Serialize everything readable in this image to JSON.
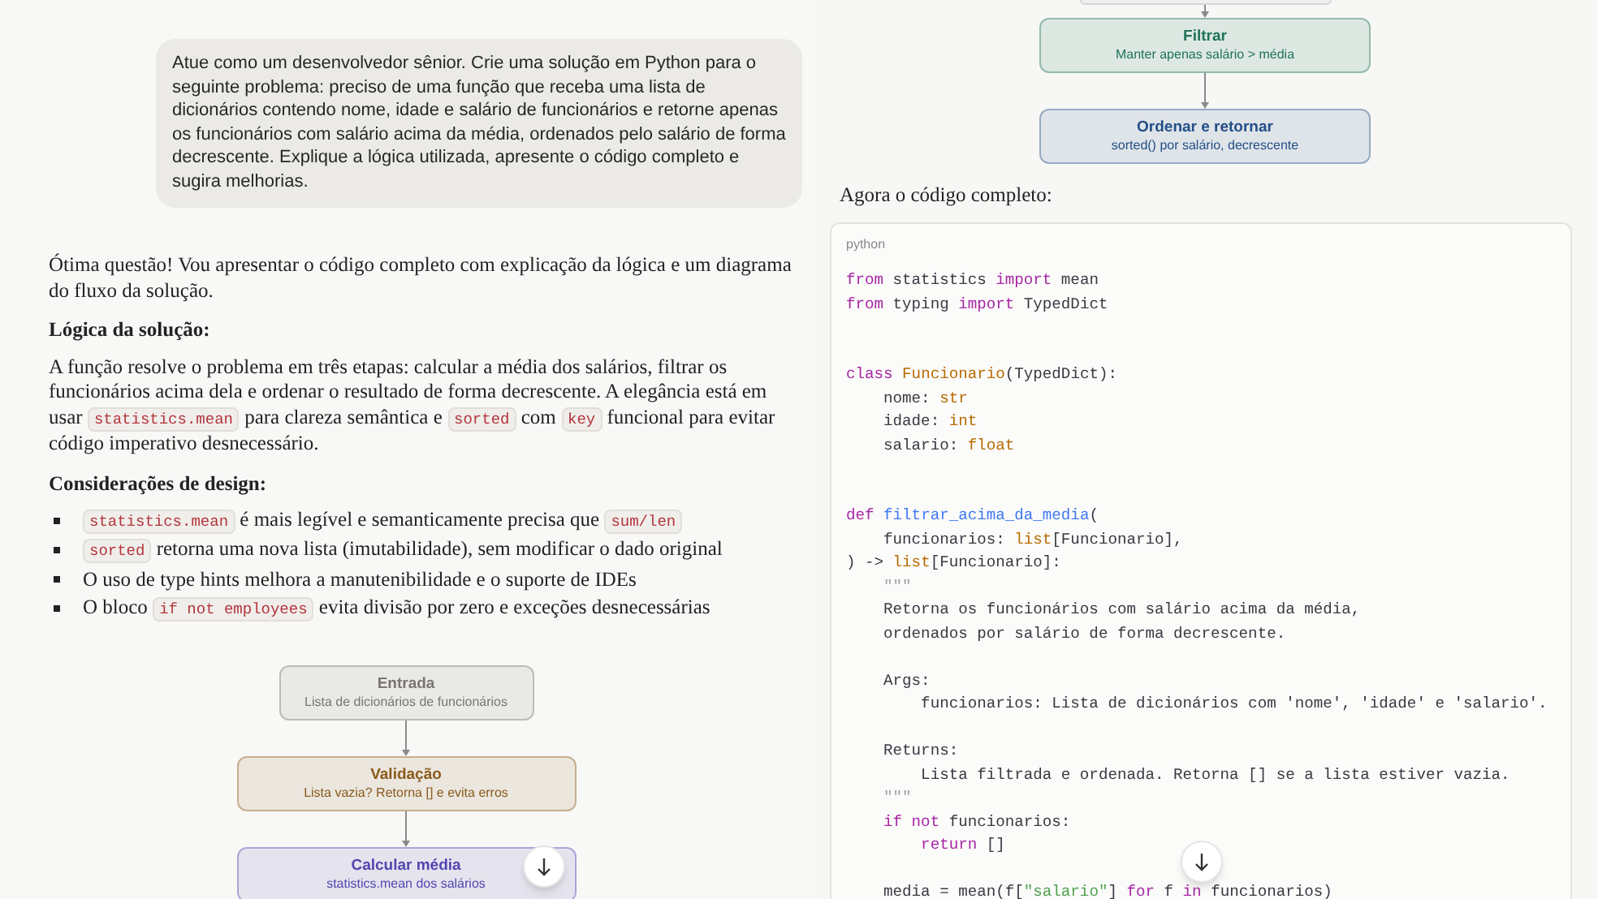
{
  "left_pane": {
    "user_message": "Atue como um desenvolvedor sênior. Crie uma solução em Python para o seguinte problema: preciso de uma função que receba uma lista de dicionários contendo nome, idade e salário de funcionários e retorne apenas os funcionários com salário acima da média, ordenados pelo salário de forma decrescente. Explique a lógica utilizada, apresente o código completo e sugira melhorias.",
    "reply_intro": "Ótima questão! Vou apresentar o código completo com explicação da lógica e um diagrama do fluxo da solução.",
    "sections": [
      {
        "heading": "Lógica da solução:",
        "kind": "paragraph",
        "paragraphs": [
          [
            {
              "text": "A função resolve o problema em três etapas: calcular a média dos salários, filtrar os funcionários acima dela e ordenar o resultado de forma decrescente. A elegância está em usar ",
              "code": false
            },
            {
              "text": "statistics.mean",
              "code": true
            },
            {
              "text": " para clareza semântica e ",
              "code": false
            },
            {
              "text": "sorted",
              "code": true
            },
            {
              "text": " com ",
              "code": false
            },
            {
              "text": "key",
              "code": true
            },
            {
              "text": " funcional para evitar código imperativo desnecessário.",
              "code": false
            }
          ]
        ]
      },
      {
        "heading": "Considerações de design:",
        "kind": "bullets",
        "paragraphs": [
          [
            {
              "text": "statistics.mean",
              "code": true
            },
            {
              "text": " é mais legível e semanticamente precisa que ",
              "code": false
            },
            {
              "text": "sum/len",
              "code": true
            }
          ],
          [
            {
              "text": "sorted",
              "code": true
            },
            {
              "text": " retorna uma nova lista (imutabilidade), sem modificar o dado original",
              "code": false
            }
          ],
          [
            {
              "text": "O uso de type hints melhora a manutenibilidade e o suporte de IDEs",
              "code": false
            }
          ],
          [
            {
              "text": "O bloco ",
              "code": false
            },
            {
              "text": "if not employees",
              "code": true
            },
            {
              "text": " evita divisão por zero e exceções desnecessárias",
              "code": false
            }
          ]
        ]
      }
    ],
    "flowchart": [
      {
        "title": "Entrada",
        "subtitle": "Lista de dicionários de funcionários",
        "color": "#7a7670"
      },
      {
        "title": "Validação",
        "subtitle": "Lista vazia? Retorna [] e evita erros",
        "color": "#8a5a1c"
      },
      {
        "title": "Calcular média",
        "subtitle": "statistics.mean dos salários",
        "color": "#5346b0"
      }
    ]
  },
  "right_pane": {
    "flowchart": [
      {
        "title": "Filtrar",
        "subtitle": "Manter apenas salário > média",
        "color": "#1f7456"
      },
      {
        "title": "Ordenar e retornar",
        "subtitle": "sorted() por salário, decrescente",
        "color": "#234f86"
      }
    ],
    "code_intro": "Agora o código completo:",
    "code_block": {
      "language": "python",
      "lines": [
        {
          "tokens": [
            {
              "kind": "keyword",
              "text": "from"
            },
            {
              "kind": "plain",
              "text": " statistics "
            },
            {
              "kind": "keyword",
              "text": "import"
            },
            {
              "kind": "plain",
              "text": " mean"
            }
          ]
        },
        {
          "tokens": [
            {
              "kind": "keyword",
              "text": "from"
            },
            {
              "kind": "plain",
              "text": " typing "
            },
            {
              "kind": "keyword",
              "text": "import"
            },
            {
              "kind": "plain",
              "text": " TypedDict"
            }
          ]
        },
        {
          "kind": "blank"
        },
        {
          "kind": "blank"
        },
        {
          "tokens": [
            {
              "kind": "keyword",
              "text": "class"
            },
            {
              "kind": "type",
              "text": " Funcionario"
            },
            {
              "kind": "plain",
              "text": "(TypedDict):"
            }
          ]
        },
        {
          "tokens": [
            {
              "kind": "plain",
              "text": "    nome: "
            },
            {
              "kind": "type",
              "text": "str"
            }
          ]
        },
        {
          "tokens": [
            {
              "kind": "plain",
              "text": "    idade: "
            },
            {
              "kind": "type",
              "text": "int"
            }
          ]
        },
        {
          "tokens": [
            {
              "kind": "plain",
              "text": "    salario: "
            },
            {
              "kind": "type",
              "text": "float"
            }
          ]
        },
        {
          "kind": "blank"
        },
        {
          "kind": "blank"
        },
        {
          "tokens": [
            {
              "kind": "keyword",
              "text": "def"
            },
            {
              "kind": "function",
              "text": " filtrar_acima_da_media"
            },
            {
              "kind": "plain",
              "text": "("
            }
          ]
        },
        {
          "tokens": [
            {
              "kind": "plain",
              "text": "    funcionarios: "
            },
            {
              "kind": "type",
              "text": "list"
            },
            {
              "kind": "plain",
              "text": "[Funcionario],"
            }
          ]
        },
        {
          "tokens": [
            {
              "kind": "plain",
              "text": ") -> "
            },
            {
              "kind": "type",
              "text": "list"
            },
            {
              "kind": "plain",
              "text": "[Funcionario]:"
            }
          ]
        },
        {
          "tokens": [
            {
              "kind": "docstring",
              "text": "    \"\"\""
            }
          ]
        },
        {
          "tokens": [
            {
              "kind": "plain",
              "text": "    Retorna os funcionários com salário acima da média,"
            }
          ]
        },
        {
          "tokens": [
            {
              "kind": "plain",
              "text": "    ordenados por salário de forma decrescente."
            }
          ]
        },
        {
          "kind": "blank"
        },
        {
          "tokens": [
            {
              "kind": "plain",
              "text": "    Args:"
            }
          ]
        },
        {
          "tokens": [
            {
              "kind": "plain",
              "text": "        funcionarios: Lista de dicionários com 'nome', 'idade' e 'salario'."
            }
          ]
        },
        {
          "kind": "blank"
        },
        {
          "tokens": [
            {
              "kind": "plain",
              "text": "    Returns:"
            }
          ]
        },
        {
          "tokens": [
            {
              "kind": "plain",
              "text": "        Lista filtrada e ordenada. Retorna [] se a lista estiver vazia."
            }
          ]
        },
        {
          "tokens": [
            {
              "kind": "docstring",
              "text": "    \"\"\""
            }
          ]
        },
        {
          "tokens": [
            {
              "kind": "keyword",
              "text": "    if not"
            },
            {
              "kind": "plain",
              "text": " funcionarios:"
            }
          ]
        },
        {
          "tokens": [
            {
              "kind": "keyword",
              "text": "        return"
            },
            {
              "kind": "plain",
              "text": " []"
            }
          ]
        },
        {
          "kind": "blank"
        },
        {
          "tokens": [
            {
              "kind": "plain",
              "text": "    media = mean(f["
            },
            {
              "kind": "string",
              "text": "\"salario\""
            },
            {
              "kind": "plain",
              "text": "] "
            },
            {
              "kind": "keyword",
              "text": "for"
            },
            {
              "kind": "plain",
              "text": " f "
            },
            {
              "kind": "keyword",
              "text": "in"
            },
            {
              "kind": "plain",
              "text": " funcionarios)"
            }
          ]
        }
      ]
    }
  }
}
